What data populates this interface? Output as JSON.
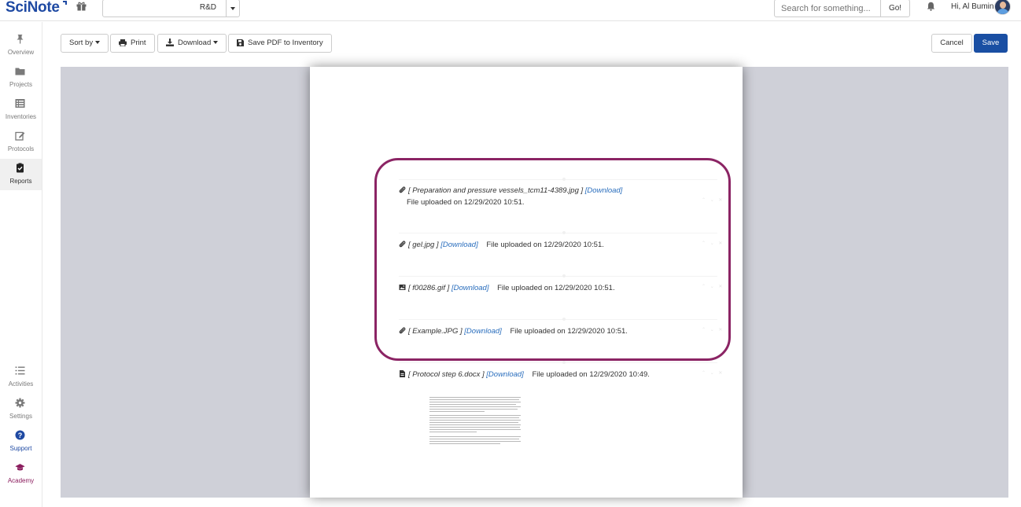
{
  "header": {
    "logo_text": "SciNote",
    "team_selector": {
      "value": "R&D"
    },
    "search": {
      "placeholder": "Search for something...",
      "go_label": "Go!"
    },
    "greeting": "Hi, Al Bumin",
    "brand_color": "#1f4aa3"
  },
  "sidebar": {
    "items": [
      {
        "label": "Overview",
        "icon": "pin-icon"
      },
      {
        "label": "Projects",
        "icon": "folder-icon"
      },
      {
        "label": "Inventories",
        "icon": "list-icon"
      },
      {
        "label": "Protocols",
        "icon": "edit-icon"
      },
      {
        "label": "Reports",
        "icon": "clipboard-check-icon",
        "active": true
      }
    ],
    "bottom_items": [
      {
        "label": "Activities",
        "icon": "activity-list-icon"
      },
      {
        "label": "Settings",
        "icon": "gear-icon"
      },
      {
        "label": "Support",
        "icon": "question-icon"
      },
      {
        "label": "Academy",
        "icon": "graduation-cap-icon"
      }
    ]
  },
  "toolbar": {
    "sort_label": "Sort by",
    "print_label": "Print",
    "download_label": "Download",
    "save_pdf_label": "Save PDF to Inventory",
    "cancel_label": "Cancel",
    "save_label": "Save",
    "save_color": "#1a4fa3"
  },
  "report": {
    "download_link": "[Download]",
    "entries": [
      {
        "file": "[ Preparation and pressure vessels_tcm11-4389.jpg ]",
        "uploaded": "File uploaded on 12/29/2020 10:51.",
        "icon": "paperclip-icon"
      },
      {
        "file": "[ gel.jpg ]",
        "uploaded": "File uploaded on 12/29/2020 10:51.",
        "icon": "paperclip-icon"
      },
      {
        "file": "[ f00286.gif ]",
        "uploaded": "File uploaded on 12/29/2020 10:51.",
        "icon": "image-icon"
      },
      {
        "file": "[ Example.JPG ]",
        "uploaded": "File uploaded on 12/29/2020 10:51.",
        "icon": "paperclip-icon"
      },
      {
        "file": "[ Protocol step 6.docx ]",
        "uploaded": "File uploaded on 12/29/2020 10:49.",
        "icon": "file-doc-icon"
      }
    ],
    "highlight_color": "#8b2464"
  }
}
